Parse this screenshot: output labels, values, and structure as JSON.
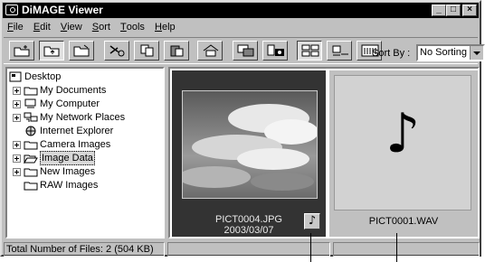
{
  "window": {
    "title": "DiMAGE Viewer"
  },
  "window_controls": {
    "minimize": "_",
    "maximize": "□",
    "close": "×"
  },
  "menu": [
    {
      "label": "File",
      "key": "F",
      "rest": "ile"
    },
    {
      "label": "Edit",
      "key": "E",
      "rest": "dit"
    },
    {
      "label": "View",
      "key": "V",
      "rest": "iew"
    },
    {
      "label": "Sort",
      "key": "S",
      "rest": "ort"
    },
    {
      "label": "Tools",
      "key": "T",
      "rest": "ools"
    },
    {
      "label": "Help",
      "key": "H",
      "rest": "elp"
    }
  ],
  "toolbar": {
    "buttons": [
      {
        "icon": "new-folder-icon"
      },
      {
        "icon": "folder-up-icon"
      },
      {
        "icon": "folder-open-icon"
      },
      {
        "icon": "cut-icon"
      },
      {
        "icon": "copy-icon"
      },
      {
        "icon": "paste-icon"
      },
      {
        "icon": "home-icon"
      },
      {
        "icon": "slideshow-icon"
      },
      {
        "icon": "camera-transfer-icon"
      },
      {
        "icon": "large-thumbnails-icon"
      },
      {
        "icon": "small-thumbnails-icon"
      },
      {
        "icon": "details-icon"
      }
    ],
    "sort_label": "Sort By :",
    "sort_value": "No Sorting"
  },
  "tree": {
    "root": "Desktop",
    "items": [
      {
        "label": "My Documents",
        "icon": "folder-documents-icon"
      },
      {
        "label": "My Computer",
        "icon": "computer-icon"
      },
      {
        "label": "My Network Places",
        "icon": "network-icon"
      },
      {
        "label": "Internet Explorer",
        "icon": "globe-icon"
      },
      {
        "label": "Camera Images",
        "icon": "folder-icon"
      },
      {
        "label": "Image Data",
        "icon": "folder-open-icon",
        "selected": true
      },
      {
        "label": "New Images",
        "icon": "folder-icon"
      },
      {
        "label": "RAW Images",
        "icon": "folder-icon"
      }
    ]
  },
  "files": [
    {
      "name": "PICT0004.JPG",
      "date": "2003/03/07",
      "type": "image",
      "has_audio": true
    },
    {
      "name": "PICT0001.WAV",
      "type": "audio"
    }
  ],
  "audio_glyph": "♪",
  "status": {
    "text": "Total Number of Files: 2 (504 KB)"
  },
  "colors": {
    "face": "#c0c0c0",
    "titlebar": "#000000",
    "selected_card": "#333333"
  }
}
